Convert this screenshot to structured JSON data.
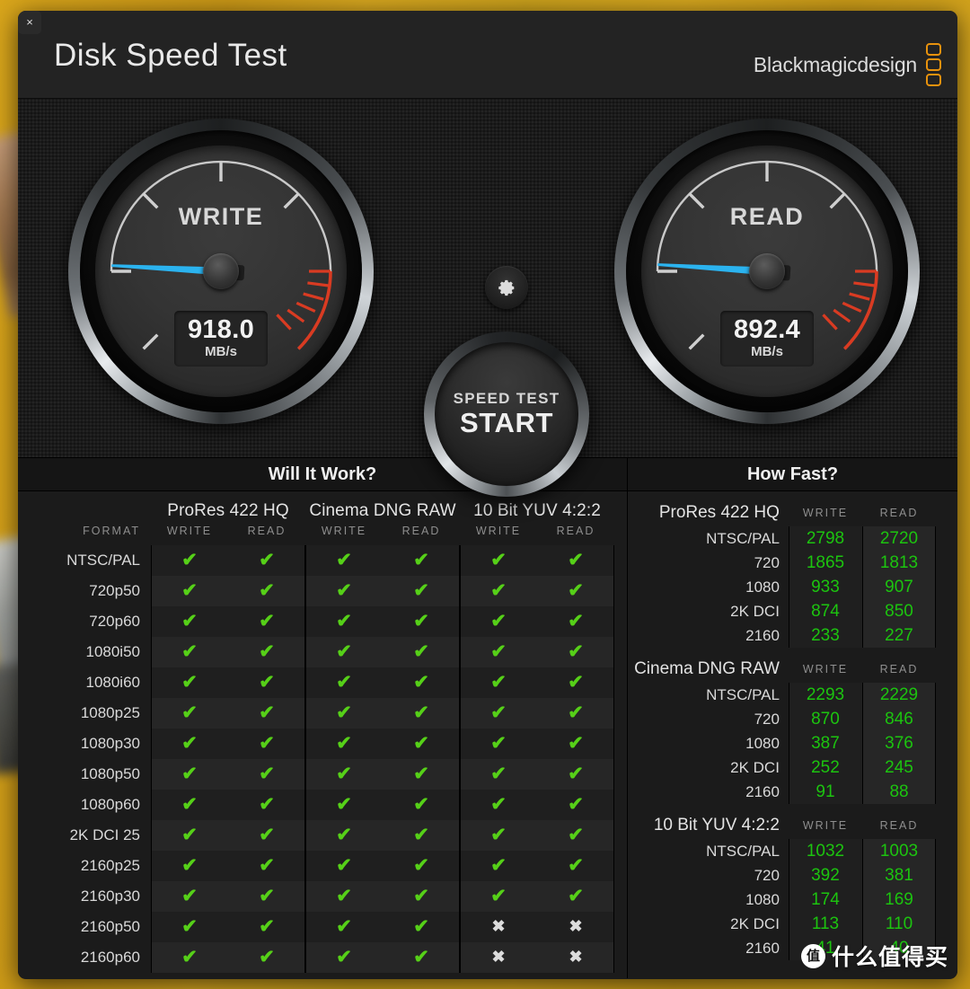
{
  "window": {
    "close_label": "×"
  },
  "header": {
    "title": "Disk Speed Test",
    "brand": "Blackmagicdesign"
  },
  "gauges": {
    "write": {
      "label": "WRITE",
      "value": "918.0",
      "unit": "MB/s"
    },
    "read": {
      "label": "READ",
      "value": "892.4",
      "unit": "MB/s"
    }
  },
  "controls": {
    "gear_icon": "gear-icon",
    "start_top": "SPEED TEST",
    "start_main": "START"
  },
  "will_it_work": {
    "title": "Will It Work?",
    "format_header": "FORMAT",
    "groups": [
      "ProRes 422 HQ",
      "Cinema DNG RAW",
      "10 Bit YUV 4:2:2"
    ],
    "sub_headers": [
      "WRITE",
      "READ"
    ],
    "tick_glyph": "✔",
    "cross_glyph": "✖",
    "rows": [
      {
        "format": "NTSC/PAL",
        "cells": [
          true,
          true,
          true,
          true,
          true,
          true
        ]
      },
      {
        "format": "720p50",
        "cells": [
          true,
          true,
          true,
          true,
          true,
          true
        ]
      },
      {
        "format": "720p60",
        "cells": [
          true,
          true,
          true,
          true,
          true,
          true
        ]
      },
      {
        "format": "1080i50",
        "cells": [
          true,
          true,
          true,
          true,
          true,
          true
        ]
      },
      {
        "format": "1080i60",
        "cells": [
          true,
          true,
          true,
          true,
          true,
          true
        ]
      },
      {
        "format": "1080p25",
        "cells": [
          true,
          true,
          true,
          true,
          true,
          true
        ]
      },
      {
        "format": "1080p30",
        "cells": [
          true,
          true,
          true,
          true,
          true,
          true
        ]
      },
      {
        "format": "1080p50",
        "cells": [
          true,
          true,
          true,
          true,
          true,
          true
        ]
      },
      {
        "format": "1080p60",
        "cells": [
          true,
          true,
          true,
          true,
          true,
          true
        ]
      },
      {
        "format": "2K DCI 25",
        "cells": [
          true,
          true,
          true,
          true,
          true,
          true
        ]
      },
      {
        "format": "2160p25",
        "cells": [
          true,
          true,
          true,
          true,
          true,
          true
        ]
      },
      {
        "format": "2160p30",
        "cells": [
          true,
          true,
          true,
          true,
          true,
          true
        ]
      },
      {
        "format": "2160p50",
        "cells": [
          true,
          true,
          true,
          true,
          false,
          false
        ]
      },
      {
        "format": "2160p60",
        "cells": [
          true,
          true,
          true,
          true,
          false,
          false
        ]
      }
    ]
  },
  "how_fast": {
    "title": "How Fast?",
    "sub_headers": [
      "WRITE",
      "READ"
    ],
    "groups": [
      {
        "name": "ProRes 422 HQ",
        "rows": [
          {
            "label": "NTSC/PAL",
            "write": "2798",
            "read": "2720"
          },
          {
            "label": "720",
            "write": "1865",
            "read": "1813"
          },
          {
            "label": "1080",
            "write": "933",
            "read": "907"
          },
          {
            "label": "2K DCI",
            "write": "874",
            "read": "850"
          },
          {
            "label": "2160",
            "write": "233",
            "read": "227"
          }
        ]
      },
      {
        "name": "Cinema DNG RAW",
        "rows": [
          {
            "label": "NTSC/PAL",
            "write": "2293",
            "read": "2229"
          },
          {
            "label": "720",
            "write": "870",
            "read": "846"
          },
          {
            "label": "1080",
            "write": "387",
            "read": "376"
          },
          {
            "label": "2K DCI",
            "write": "252",
            "read": "245"
          },
          {
            "label": "2160",
            "write": "91",
            "read": "88"
          }
        ]
      },
      {
        "name": "10 Bit YUV 4:2:2",
        "rows": [
          {
            "label": "NTSC/PAL",
            "write": "1032",
            "read": "1003"
          },
          {
            "label": "720",
            "write": "392",
            "read": "381"
          },
          {
            "label": "1080",
            "write": "174",
            "read": "169"
          },
          {
            "label": "2K DCI",
            "write": "113",
            "read": "110"
          },
          {
            "label": "2160",
            "write": "41",
            "read": "40"
          }
        ]
      }
    ]
  },
  "watermark": {
    "badge": "值",
    "text": "什么值得买"
  },
  "colors": {
    "accent_orange": "#e8920d",
    "needle_blue": "#2bb3ef",
    "tick_green": "#56d018",
    "value_green": "#1cc40f",
    "redzone": "#d93b22"
  }
}
